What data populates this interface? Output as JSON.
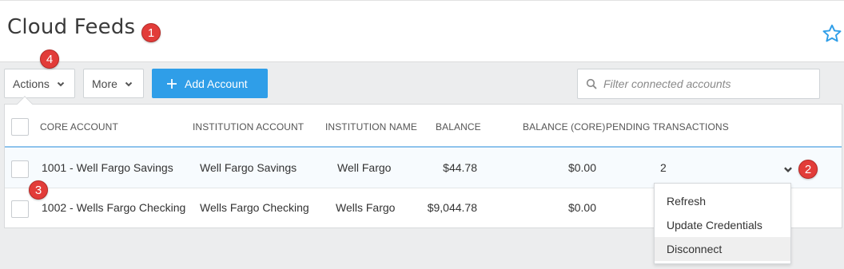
{
  "header": {
    "title": "Cloud Feeds"
  },
  "icons": {
    "favorite": "star-icon",
    "search": "search-icon",
    "dropdown": "chevron-down-icon",
    "add": "plus-icon"
  },
  "toolbar": {
    "actions_label": "Actions",
    "more_label": "More",
    "add_account_label": "Add Account",
    "filter_placeholder": "Filter connected accounts"
  },
  "table": {
    "columns": [
      "CORE ACCOUNT",
      "INSTITUTION ACCOUNT",
      "INSTITUTION NAME",
      "BALANCE",
      "BALANCE (CORE)",
      "PENDING TRANSACTIONS"
    ],
    "rows": [
      {
        "core_account": "1001 - Well Fargo Savings",
        "institution_account": "Well Fargo Savings",
        "institution_name": "Well Fargo",
        "balance": "$44.78",
        "balance_core": "$0.00",
        "pending": "2"
      },
      {
        "core_account": "1002 - Wells Fargo Checking",
        "institution_account": "Wells Fargo Checking",
        "institution_name": "Wells Fargo",
        "balance": "$9,044.78",
        "balance_core": "$0.00",
        "pending": ""
      }
    ]
  },
  "row_menu": {
    "items": [
      "Refresh",
      "Update Credentials",
      "Disconnect"
    ],
    "highlighted": "Disconnect"
  },
  "annotations": [
    "1",
    "2",
    "3",
    "4"
  ],
  "colors": {
    "accent_blue": "#2f9ee8",
    "star_blue": "#2f9ee8",
    "badge_red": "#e23c39",
    "header_bg": "#ffffff",
    "page_bg": "#ecedee"
  }
}
